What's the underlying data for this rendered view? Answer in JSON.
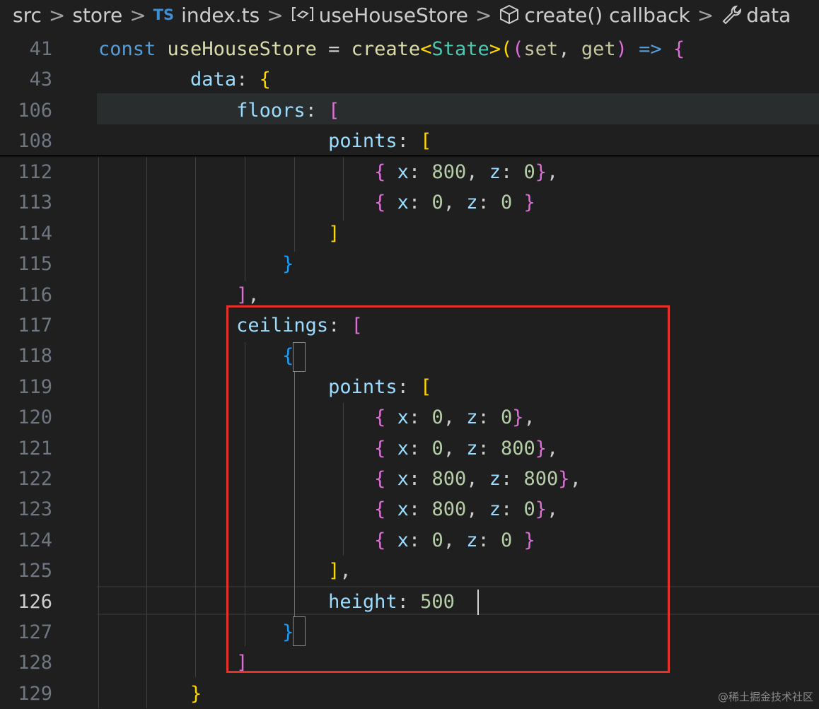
{
  "breadcrumb": {
    "items": [
      {
        "label": "src",
        "icon": "none"
      },
      {
        "label": "store",
        "icon": "none"
      },
      {
        "label": "index.ts",
        "icon": "typescript-file-icon",
        "badge": "TS"
      },
      {
        "label": "useHouseStore",
        "icon": "variable-icon"
      },
      {
        "label": "create() callback",
        "icon": "method-cube-icon"
      },
      {
        "label": "data",
        "icon": "wrench-property-icon"
      }
    ],
    "separator": ">"
  },
  "editor": {
    "cursor_line": "126",
    "sticky_lines": [
      "41",
      "43",
      "106",
      "108"
    ],
    "lines": [
      {
        "n": "41",
        "tokens": [
          [
            "kw",
            "const "
          ],
          [
            "fn",
            "useHouseStore"
          ],
          [
            "op",
            " = "
          ],
          [
            "fn",
            "create"
          ],
          [
            "b1",
            "<"
          ],
          [
            "ty",
            "State"
          ],
          [
            "b1",
            ">"
          ],
          [
            "b1",
            "("
          ],
          [
            "b2",
            "("
          ],
          [
            "pa",
            "set"
          ],
          [
            "op",
            ", "
          ],
          [
            "pa",
            "get"
          ],
          [
            "b2",
            ")"
          ],
          [
            "kw",
            " => "
          ],
          [
            "b2",
            "{"
          ]
        ]
      },
      {
        "n": "43",
        "tokens": [
          [
            "op",
            "        "
          ],
          [
            "prop",
            "data"
          ],
          [
            "op",
            ": "
          ],
          [
            "b1",
            "{"
          ]
        ]
      },
      {
        "n": "106",
        "tokens": [
          [
            "op",
            "            "
          ],
          [
            "prop",
            "floors"
          ],
          [
            "op",
            ": "
          ],
          [
            "b2",
            "["
          ]
        ]
      },
      {
        "n": "108",
        "tokens": [
          [
            "op",
            "                    "
          ],
          [
            "prop",
            "points"
          ],
          [
            "op",
            ": "
          ],
          [
            "b1",
            "["
          ]
        ]
      },
      {
        "n": "112",
        "tokens": [
          [
            "op",
            "                        "
          ],
          [
            "b2",
            "{"
          ],
          [
            "prop",
            " x"
          ],
          [
            "op",
            ": "
          ],
          [
            "num",
            "800"
          ],
          [
            "op",
            ", "
          ],
          [
            "prop",
            "z"
          ],
          [
            "op",
            ": "
          ],
          [
            "num",
            "0"
          ],
          [
            "b2",
            "}"
          ],
          [
            "op",
            ","
          ]
        ]
      },
      {
        "n": "113",
        "tokens": [
          [
            "op",
            "                        "
          ],
          [
            "b2",
            "{"
          ],
          [
            "prop",
            " x"
          ],
          [
            "op",
            ": "
          ],
          [
            "num",
            "0"
          ],
          [
            "op",
            ", "
          ],
          [
            "prop",
            "z"
          ],
          [
            "op",
            ": "
          ],
          [
            "num",
            "0"
          ],
          [
            "op",
            " "
          ],
          [
            "b2",
            "}"
          ]
        ]
      },
      {
        "n": "114",
        "tokens": [
          [
            "op",
            "                    "
          ],
          [
            "b1",
            "]"
          ]
        ]
      },
      {
        "n": "115",
        "tokens": [
          [
            "op",
            "                "
          ],
          [
            "b3",
            "}"
          ]
        ]
      },
      {
        "n": "116",
        "tokens": [
          [
            "op",
            "            "
          ],
          [
            "b2",
            "]"
          ],
          [
            "op",
            ","
          ]
        ]
      },
      {
        "n": "117",
        "tokens": [
          [
            "op",
            "            "
          ],
          [
            "prop",
            "ceilings"
          ],
          [
            "op",
            ": "
          ],
          [
            "b2",
            "["
          ]
        ]
      },
      {
        "n": "118",
        "tokens": [
          [
            "op",
            "                "
          ],
          [
            "b3",
            "{"
          ]
        ]
      },
      {
        "n": "119",
        "tokens": [
          [
            "op",
            "                    "
          ],
          [
            "prop",
            "points"
          ],
          [
            "op",
            ": "
          ],
          [
            "b1",
            "["
          ]
        ]
      },
      {
        "n": "120",
        "tokens": [
          [
            "op",
            "                        "
          ],
          [
            "b2",
            "{"
          ],
          [
            "prop",
            " x"
          ],
          [
            "op",
            ": "
          ],
          [
            "num",
            "0"
          ],
          [
            "op",
            ", "
          ],
          [
            "prop",
            "z"
          ],
          [
            "op",
            ": "
          ],
          [
            "num",
            "0"
          ],
          [
            "b2",
            "}"
          ],
          [
            "op",
            ","
          ]
        ]
      },
      {
        "n": "121",
        "tokens": [
          [
            "op",
            "                        "
          ],
          [
            "b2",
            "{"
          ],
          [
            "prop",
            " x"
          ],
          [
            "op",
            ": "
          ],
          [
            "num",
            "0"
          ],
          [
            "op",
            ", "
          ],
          [
            "prop",
            "z"
          ],
          [
            "op",
            ": "
          ],
          [
            "num",
            "800"
          ],
          [
            "b2",
            "}"
          ],
          [
            "op",
            ","
          ]
        ]
      },
      {
        "n": "122",
        "tokens": [
          [
            "op",
            "                        "
          ],
          [
            "b2",
            "{"
          ],
          [
            "prop",
            " x"
          ],
          [
            "op",
            ": "
          ],
          [
            "num",
            "800"
          ],
          [
            "op",
            ", "
          ],
          [
            "prop",
            "z"
          ],
          [
            "op",
            ": "
          ],
          [
            "num",
            "800"
          ],
          [
            "b2",
            "}"
          ],
          [
            "op",
            ","
          ]
        ]
      },
      {
        "n": "123",
        "tokens": [
          [
            "op",
            "                        "
          ],
          [
            "b2",
            "{"
          ],
          [
            "prop",
            " x"
          ],
          [
            "op",
            ": "
          ],
          [
            "num",
            "800"
          ],
          [
            "op",
            ", "
          ],
          [
            "prop",
            "z"
          ],
          [
            "op",
            ": "
          ],
          [
            "num",
            "0"
          ],
          [
            "b2",
            "}"
          ],
          [
            "op",
            ","
          ]
        ]
      },
      {
        "n": "124",
        "tokens": [
          [
            "op",
            "                        "
          ],
          [
            "b2",
            "{"
          ],
          [
            "prop",
            " x"
          ],
          [
            "op",
            ": "
          ],
          [
            "num",
            "0"
          ],
          [
            "op",
            ", "
          ],
          [
            "prop",
            "z"
          ],
          [
            "op",
            ": "
          ],
          [
            "num",
            "0"
          ],
          [
            "op",
            " "
          ],
          [
            "b2",
            "}"
          ]
        ]
      },
      {
        "n": "125",
        "tokens": [
          [
            "op",
            "                    "
          ],
          [
            "b1",
            "]"
          ],
          [
            "op",
            ","
          ]
        ]
      },
      {
        "n": "126",
        "tokens": [
          [
            "op",
            "                    "
          ],
          [
            "prop",
            "height"
          ],
          [
            "op",
            ": "
          ],
          [
            "num",
            "500"
          ]
        ]
      },
      {
        "n": "127",
        "tokens": [
          [
            "op",
            "                "
          ],
          [
            "b3",
            "}"
          ]
        ]
      },
      {
        "n": "128",
        "tokens": [
          [
            "op",
            "            "
          ],
          [
            "b2",
            "]"
          ]
        ]
      },
      {
        "n": "129",
        "tokens": [
          [
            "op",
            "        "
          ],
          [
            "b1",
            "}"
          ]
        ]
      }
    ]
  },
  "colors": {
    "background": "#1f1f1f",
    "highlight_box": "#e5332a"
  },
  "watermark": "@稀土掘金技术社区"
}
